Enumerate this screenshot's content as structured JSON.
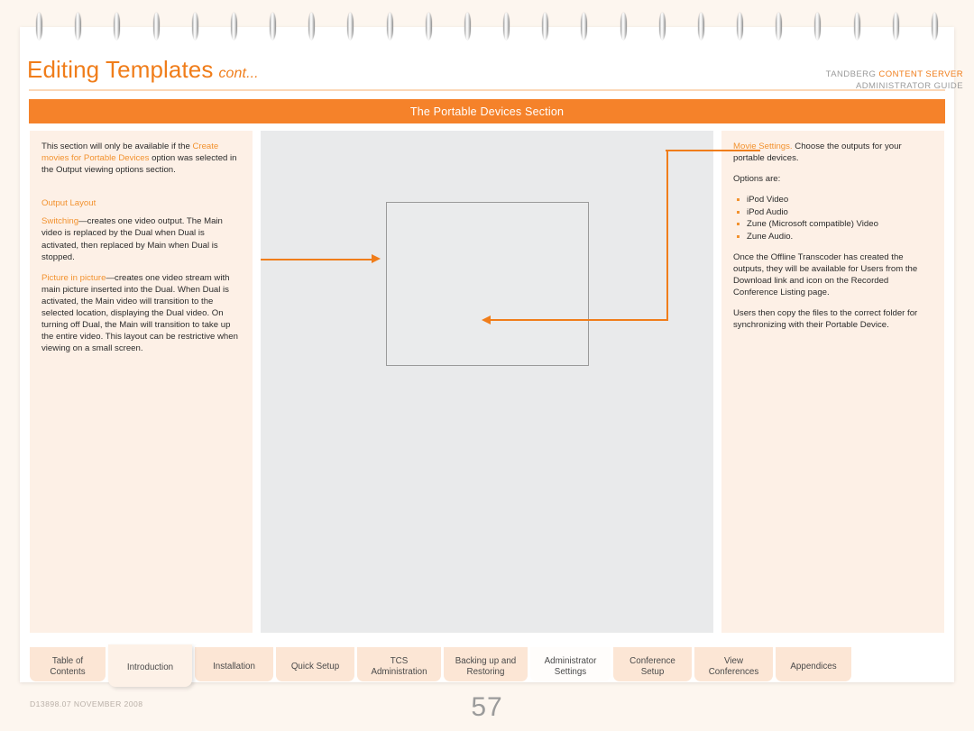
{
  "document": {
    "title": "Editing Templates",
    "title_suffix": "cont...",
    "guide_line1_prefix": "TANDBERG ",
    "guide_line1_accent": "CONTENT SERVER",
    "guide_line2": "ADMINISTRATOR GUIDE",
    "banner": "The Portable Devices Section",
    "doc_code": "D13898.07\nNOVEMBER 2008",
    "page_number": "57",
    "accent_color": "#f07d1a",
    "banner_color": "#f5822a",
    "column_bg_color": "#fdf0e6",
    "center_bg_color": "#e9eaeb"
  },
  "binding": {
    "ring_count": 24,
    "icon": "spiral-ring"
  },
  "left_column": {
    "intro_part1": "This section will only be available if the ",
    "intro_accent": "Create movies for Portable Devices",
    "intro_part2": " option was selected in the Output viewing options section.",
    "section_heading": "Output Layout",
    "switching_label": "Switching",
    "switching_text": "—creates one video output. The Main video is replaced by the Dual when Dual is activated, then replaced by Main when Dual is stopped.",
    "pip_label": "Picture in picture",
    "pip_text": "—creates one video stream with main picture inserted into the Dual. When Dual is activated, the Main video will transition to the selected location, displaying the Dual video. On turning off Dual, the Main will transition to take up the entire video. This layout can be restrictive when viewing on a small screen."
  },
  "right_column": {
    "movie_settings_label": "Movie Settings.",
    "movie_settings_text": " Choose the outputs for your portable devices.",
    "options_intro": "Options are:",
    "options": [
      "iPod Video",
      "iPod Audio",
      "Zune (Microsoft compatible) Video",
      "Zune Audio."
    ],
    "transcoder_text": "Once the Offline Transcoder has created the outputs, they will be available for Users from the Download link and icon on the Recorded Conference Listing page.",
    "sync_text": "Users then copy the files to the correct folder for synchronizing with their Portable Device."
  },
  "center": {
    "placeholder_label": "",
    "callout_left_icon": "arrow-right-icon",
    "callout_right_icon": "arrow-left-icon"
  },
  "tabs": [
    {
      "label": "Table of\nContents",
      "state": "normal"
    },
    {
      "label": "Introduction",
      "state": "raised"
    },
    {
      "label": "Installation",
      "state": "normal"
    },
    {
      "label": "Quick Setup",
      "state": "normal"
    },
    {
      "label": "TCS\nAdministration",
      "state": "normal"
    },
    {
      "label": "Backing up and\nRestoring",
      "state": "normal"
    },
    {
      "label": "Administrator\nSettings",
      "state": "light"
    },
    {
      "label": "Conference\nSetup",
      "state": "normal"
    },
    {
      "label": "View\nConferences",
      "state": "normal"
    },
    {
      "label": "Appendices",
      "state": "normal"
    }
  ]
}
